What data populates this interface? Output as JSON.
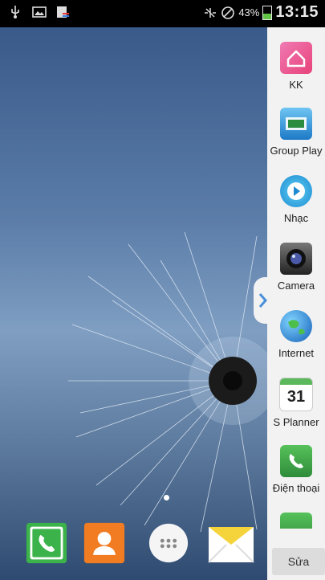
{
  "status_bar": {
    "battery_percent": "43%",
    "battery_level": 0.43,
    "time": "13:15",
    "icons": [
      "usb-icon",
      "gallery-icon",
      "news-icon",
      "silent-icon",
      "no-sim-icon",
      "battery-icon"
    ]
  },
  "sidebar": {
    "apps": [
      {
        "label": "KK",
        "icon": "kk-home-icon"
      },
      {
        "label": "Group Play",
        "icon": "group-play-icon"
      },
      {
        "label": "Nhạc",
        "icon": "music-icon"
      },
      {
        "label": "Camera",
        "icon": "camera-icon"
      },
      {
        "label": "Internet",
        "icon": "internet-globe-icon"
      },
      {
        "label": "S Planner",
        "icon": "calendar-icon",
        "date": "31"
      },
      {
        "label": "Điện thoại",
        "icon": "phone-icon"
      }
    ],
    "edit_label": "Sửa"
  },
  "dock": {
    "apps": [
      {
        "icon": "phone-icon"
      },
      {
        "icon": "contacts-icon"
      },
      {
        "icon": "apps-icon"
      },
      {
        "icon": "messages-icon"
      }
    ]
  },
  "colors": {
    "accent_green": "#3bb34a",
    "contacts_orange": "#f27c22",
    "sidebar_bg": "#f2f2f2"
  }
}
